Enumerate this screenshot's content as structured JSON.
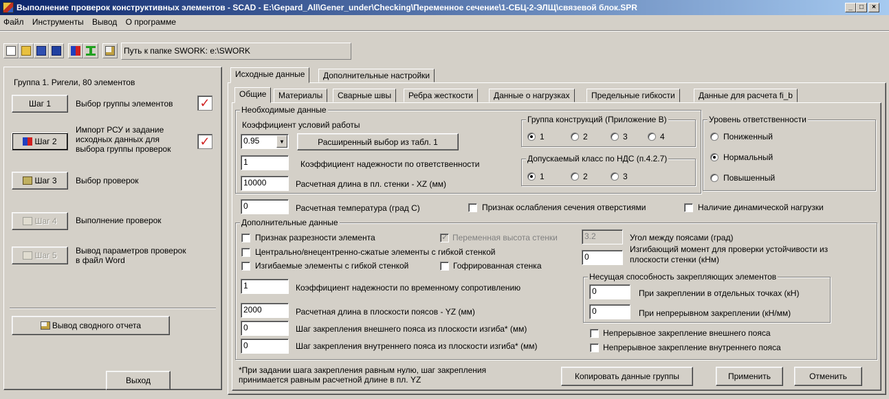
{
  "window": {
    "title": "Выполнение проверок конструктивных элементов - SCAD - E:\\Gepard_All\\Gener_under\\Checking\\Переменное сечение\\1-СБЦ-2-ЭЛЩ\\связевой блок.SPR",
    "minimize": "_",
    "maximize": "□",
    "close": "×"
  },
  "menu": [
    "Файл",
    "Инструменты",
    "Вывод",
    "О программе"
  ],
  "toolbar": {
    "icons": [
      "new-file-icon",
      "open-folder-icon",
      "save-icon",
      "save-as-icon",
      "import-icon",
      "beam-icon",
      "report-icon"
    ],
    "swork_path": "Путь к папке SWORK: e:\\SWORK"
  },
  "left": {
    "group_info": "Группа 1. Ригели, 80 элементов",
    "steps": [
      {
        "button": "Шаг 1",
        "text": "Выбор группы элементов",
        "done": true
      },
      {
        "button": "Шаг 2",
        "text": "Импорт РСУ и задание исходных данных для выбора группы проверок",
        "done": true
      },
      {
        "button": "Шаг 3",
        "text": "Выбор проверок"
      },
      {
        "button": "Шаг 4",
        "text": "Выполнение проверок"
      },
      {
        "button": "Шаг 5",
        "text": "Вывод параметров проверок в файл Word"
      }
    ],
    "summary_button": "Вывод сводного отчета",
    "exit_button": "Выход"
  },
  "outer_tabs": [
    "Исходные данные",
    "Дополнительные настройки"
  ],
  "inner_tabs": [
    "Общие",
    "Материалы",
    "Сварные швы",
    "Ребра жесткости",
    "Данные о нагрузках",
    "Предельные гибкости",
    "Данные для расчета fi_b"
  ],
  "required": {
    "legend": "Необходимые данные",
    "work_coef_label": "Коэффициент условий работы",
    "work_coef_value": "0.95",
    "extended_button": "Расширенный выбор из табл. 1",
    "reliability_value": "1",
    "reliability_label": "Коэффициент надежности по ответственности",
    "length_value": "10000",
    "length_label": "Расчетная длина в пл. стенки - XZ (мм)",
    "construction_group": {
      "legend": "Группа конструкций (Приложение В)",
      "options": [
        "1",
        "2",
        "3",
        "4"
      ],
      "selected": "1"
    },
    "ndc_class": {
      "legend": "Допускаемый класс по НДС (п.4.2.7)",
      "options": [
        "1",
        "2",
        "3"
      ],
      "selected": "1"
    },
    "responsibility": {
      "legend": "Уровень ответственности",
      "options": [
        "Пониженный",
        "Нормальный",
        "Повышенный"
      ],
      "selected": "Нормальный"
    }
  },
  "temperature": {
    "value": "0",
    "label": "Расчетная температура (град С)",
    "holes_label": "Признак ослабления сечения отверстиями",
    "dynamic_label": "Наличие динамической нагрузки"
  },
  "additional": {
    "legend": "Дополнительные данные",
    "split_label": "Признак разрезности элемента",
    "variable_height_label": "Переменная высота стенки",
    "angle_value": "3.2",
    "angle_label": "Угол между поясами (град)",
    "central_label": "Центрально/внецентренно-сжатые элементы с гибкой стенкой",
    "moment_value": "0",
    "moment_label": "Изгибающий момент для проверки устойчивости из плоскости стенки (кНм)",
    "bent_label": "Изгибаемые элементы с гибкой стенкой",
    "corrugated_label": "Гофрированная стенка",
    "temp_resist_value": "1",
    "temp_resist_label": "Коэффициент надежности по временному сопротивлению",
    "chord_len_value": "2000",
    "chord_len_label": "Расчетная длина в плоскости поясов - YZ (мм)",
    "outer_step_value": "0",
    "outer_step_label": "Шаг закрепления внешнего пояса из плоскости изгиба* (мм)",
    "inner_step_value": "0",
    "inner_step_label": "Шаг закрепления внутреннего пояса из плоскости изгиба* (мм)",
    "bearing": {
      "legend": "Несущая способность закрепляющих элементов",
      "points_value": "0",
      "points_label": "При закреплении в отдельных точках (кН)",
      "continuous_value": "0",
      "continuous_label": "При непрерывном закреплении (кН/мм)"
    },
    "cont_outer_label": "Непрерывное закрепление внешнего пояса",
    "cont_inner_label": "Непрерывное закрепление внутреннего пояса"
  },
  "footnote": "*При задании шага закрепления равным нулю, шаг закрепления принимается равным расчетной длине в пл. YZ",
  "bottom_buttons": {
    "copy": "Копировать данные группы",
    "apply": "Применить",
    "cancel": "Отменить"
  }
}
